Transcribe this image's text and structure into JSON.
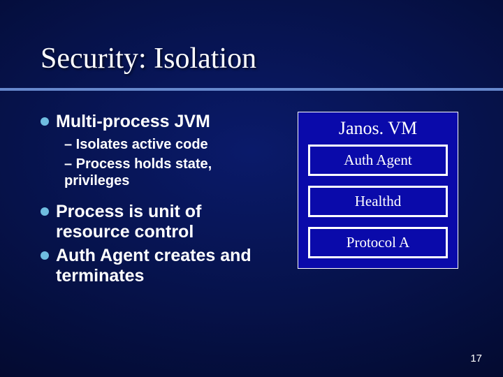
{
  "title": "Security: Isolation",
  "bullets": {
    "main1": "Multi-process JVM",
    "sub1a": "– Isolates active code",
    "sub1b": "– Process holds state, privileges",
    "main2": "Process is unit of resource control",
    "main3": "Auth Agent creates and terminates"
  },
  "diagram": {
    "title": "Janos. VM",
    "box1": "Auth Agent",
    "box2": "Healthd",
    "box3": "Protocol A"
  },
  "page_number": "17"
}
